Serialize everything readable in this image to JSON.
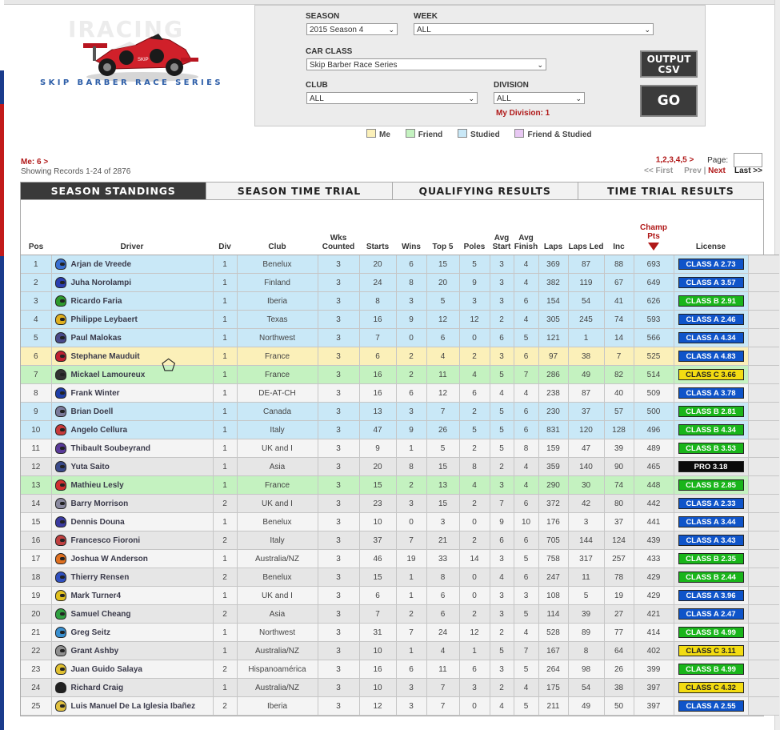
{
  "logo": {
    "word": "IRACING",
    "subtitle": "SKIP BARBER RACE SERIES"
  },
  "filters": {
    "season": {
      "label": "SEASON",
      "value": "2015 Season 4"
    },
    "week": {
      "label": "WEEK",
      "value": "ALL"
    },
    "car_class": {
      "label": "CAR CLASS",
      "value": "Skip Barber Race Series"
    },
    "club": {
      "label": "CLUB",
      "value": "ALL"
    },
    "division": {
      "label": "DIVISION",
      "value": "ALL"
    },
    "my_division": "My Division: 1",
    "output_csv": "OUTPUT CSV",
    "go": "GO"
  },
  "legend": [
    {
      "label": "Me",
      "color": "#fbf0b9"
    },
    {
      "label": "Friend",
      "color": "#c4f2c0"
    },
    {
      "label": "Studied",
      "color": "#c9e8f7"
    },
    {
      "label": "Friend & Studied",
      "color": "#e8c8f3"
    }
  ],
  "me_link": "Me: 6 >",
  "showing": "Showing Records 1-24 of 2876",
  "pagination": {
    "pages": "1,2,3,4,5",
    "next_arrow": ">",
    "page_label": "Page:",
    "first": "<< First",
    "prev": "Prev",
    "sep": "|",
    "next": "Next",
    "last": "Last >>"
  },
  "tabs": [
    "SEASON STANDINGS",
    "SEASON TIME TRIAL",
    "QUALIFYING RESULTS",
    "TIME TRIAL RESULTS"
  ],
  "columns": {
    "pos": "Pos",
    "driver": "Driver",
    "div": "Div",
    "club": "Club",
    "wks": "Wks Counted",
    "starts": "Starts",
    "wins": "Wins",
    "top5": "Top 5",
    "poles": "Poles",
    "avg_start": "Avg Start",
    "avg_finish": "Avg Finish",
    "laps": "Laps",
    "laps_led": "Laps Led",
    "inc": "Inc",
    "champ": "Champ Pts",
    "license": "License"
  },
  "rows": [
    {
      "pos": "1",
      "driver": "Arjan de Vreede",
      "div": "1",
      "club": "Benelux",
      "wks": "3",
      "starts": "20",
      "wins": "6",
      "top5": "15",
      "poles": "5",
      "as": "3",
      "af": "4",
      "laps": "369",
      "led": "87",
      "inc": "88",
      "pts": "693",
      "lic": "CLASS A 2.73",
      "cls": "A",
      "type": "studied",
      "helmet": "#3a6fd1"
    },
    {
      "pos": "2",
      "driver": "Juha Norolampi",
      "div": "1",
      "club": "Finland",
      "wks": "3",
      "starts": "24",
      "wins": "8",
      "top5": "20",
      "poles": "9",
      "as": "3",
      "af": "4",
      "laps": "382",
      "led": "119",
      "inc": "67",
      "pts": "649",
      "lic": "CLASS A 3.57",
      "cls": "A",
      "type": "studied",
      "helmet": "#2b3fb0"
    },
    {
      "pos": "3",
      "driver": "Ricardo Faria",
      "div": "1",
      "club": "Iberia",
      "wks": "3",
      "starts": "8",
      "wins": "3",
      "top5": "5",
      "poles": "3",
      "as": "3",
      "af": "6",
      "laps": "154",
      "led": "54",
      "inc": "41",
      "pts": "626",
      "lic": "CLASS B 2.91",
      "cls": "B",
      "type": "studied",
      "helmet": "#2e9b2e"
    },
    {
      "pos": "4",
      "driver": "Philippe Leybaert",
      "div": "1",
      "club": "Texas",
      "wks": "3",
      "starts": "16",
      "wins": "9",
      "top5": "12",
      "poles": "12",
      "as": "2",
      "af": "4",
      "laps": "305",
      "led": "245",
      "inc": "74",
      "pts": "593",
      "lic": "CLASS A 2.46",
      "cls": "A",
      "type": "studied",
      "helmet": "#e0b020"
    },
    {
      "pos": "5",
      "driver": "Paul Malokas",
      "div": "1",
      "club": "Northwest",
      "wks": "3",
      "starts": "7",
      "wins": "0",
      "top5": "6",
      "poles": "0",
      "as": "6",
      "af": "5",
      "laps": "121",
      "led": "1",
      "inc": "14",
      "pts": "566",
      "lic": "CLASS A 4.34",
      "cls": "A",
      "type": "studied",
      "helmet": "#4a4a8a"
    },
    {
      "pos": "6",
      "driver": "Stephane Mauduit",
      "div": "1",
      "club": "France",
      "wks": "3",
      "starts": "6",
      "wins": "2",
      "top5": "4",
      "poles": "2",
      "as": "3",
      "af": "6",
      "laps": "97",
      "led": "38",
      "inc": "7",
      "pts": "525",
      "lic": "CLASS A 4.83",
      "cls": "A",
      "type": "me",
      "helmet": "#c02030"
    },
    {
      "pos": "7",
      "driver": "Mickael Lamoureux",
      "div": "1",
      "club": "France",
      "wks": "3",
      "starts": "16",
      "wins": "2",
      "top5": "11",
      "poles": "4",
      "as": "5",
      "af": "7",
      "laps": "286",
      "led": "49",
      "inc": "82",
      "pts": "514",
      "lic": "CLASS C 3.66",
      "cls": "C",
      "type": "friend",
      "helmet": "#333333"
    },
    {
      "pos": "8",
      "driver": "Frank Winter",
      "div": "1",
      "club": "DE-AT-CH",
      "wks": "3",
      "starts": "16",
      "wins": "6",
      "top5": "12",
      "poles": "6",
      "as": "4",
      "af": "4",
      "laps": "238",
      "led": "87",
      "inc": "40",
      "pts": "509",
      "lic": "CLASS A 3.78",
      "cls": "A",
      "type": "norm",
      "helmet": "#1f3fa8"
    },
    {
      "pos": "9",
      "driver": "Brian Doell",
      "div": "1",
      "club": "Canada",
      "wks": "3",
      "starts": "13",
      "wins": "3",
      "top5": "7",
      "poles": "2",
      "as": "5",
      "af": "6",
      "laps": "230",
      "led": "37",
      "inc": "57",
      "pts": "500",
      "lic": "CLASS B 2.81",
      "cls": "B",
      "type": "studied",
      "helmet": "#7a7a9a"
    },
    {
      "pos": "10",
      "driver": "Angelo Cellura",
      "div": "1",
      "club": "Italy",
      "wks": "3",
      "starts": "47",
      "wins": "9",
      "top5": "26",
      "poles": "5",
      "as": "5",
      "af": "6",
      "laps": "831",
      "led": "120",
      "inc": "128",
      "pts": "496",
      "lic": "CLASS B 4.34",
      "cls": "B",
      "type": "studied",
      "helmet": "#c83a3a"
    },
    {
      "pos": "11",
      "driver": "Thibault Soubeyrand",
      "div": "1",
      "club": "UK and I",
      "wks": "3",
      "starts": "9",
      "wins": "1",
      "top5": "5",
      "poles": "2",
      "as": "5",
      "af": "8",
      "laps": "159",
      "led": "47",
      "inc": "39",
      "pts": "489",
      "lic": "CLASS B 3.53",
      "cls": "B",
      "type": "norm",
      "helmet": "#5a3a9a"
    },
    {
      "pos": "12",
      "driver": "Yuta Saito",
      "div": "1",
      "club": "Asia",
      "wks": "3",
      "starts": "20",
      "wins": "8",
      "top5": "15",
      "poles": "8",
      "as": "2",
      "af": "4",
      "laps": "359",
      "led": "140",
      "inc": "90",
      "pts": "465",
      "lic": "PRO 3.18",
      "cls": "P",
      "type": "norm alt",
      "helmet": "#3a4a8a"
    },
    {
      "pos": "13",
      "driver": "Mathieu Lesly",
      "div": "1",
      "club": "France",
      "wks": "3",
      "starts": "15",
      "wins": "2",
      "top5": "13",
      "poles": "4",
      "as": "3",
      "af": "4",
      "laps": "290",
      "led": "30",
      "inc": "74",
      "pts": "448",
      "lic": "CLASS B 2.85",
      "cls": "B",
      "type": "friend",
      "helmet": "#d03030"
    },
    {
      "pos": "14",
      "driver": "Barry Morrison",
      "div": "2",
      "club": "UK and I",
      "wks": "3",
      "starts": "23",
      "wins": "3",
      "top5": "15",
      "poles": "2",
      "as": "7",
      "af": "6",
      "laps": "372",
      "led": "42",
      "inc": "80",
      "pts": "442",
      "lic": "CLASS A 2.33",
      "cls": "A",
      "type": "norm alt",
      "helmet": "#8a8aa0"
    },
    {
      "pos": "15",
      "driver": "Dennis Douna",
      "div": "1",
      "club": "Benelux",
      "wks": "3",
      "starts": "10",
      "wins": "0",
      "top5": "3",
      "poles": "0",
      "as": "9",
      "af": "10",
      "laps": "176",
      "led": "3",
      "inc": "37",
      "pts": "441",
      "lic": "CLASS A 3.44",
      "cls": "A",
      "type": "norm",
      "helmet": "#3a3aa0"
    },
    {
      "pos": "16",
      "driver": "Francesco Fioroni",
      "div": "2",
      "club": "Italy",
      "wks": "3",
      "starts": "37",
      "wins": "7",
      "top5": "21",
      "poles": "2",
      "as": "6",
      "af": "6",
      "laps": "705",
      "led": "144",
      "inc": "124",
      "pts": "439",
      "lic": "CLASS A 3.43",
      "cls": "A",
      "type": "norm alt",
      "helmet": "#c04040"
    },
    {
      "pos": "17",
      "driver": "Joshua W Anderson",
      "div": "1",
      "club": "Australia/NZ",
      "wks": "3",
      "starts": "46",
      "wins": "19",
      "top5": "33",
      "poles": "14",
      "as": "3",
      "af": "5",
      "laps": "758",
      "led": "317",
      "inc": "257",
      "pts": "433",
      "lic": "CLASS B 2.35",
      "cls": "B",
      "type": "norm",
      "helmet": "#e07020"
    },
    {
      "pos": "18",
      "driver": "Thierry Rensen",
      "div": "2",
      "club": "Benelux",
      "wks": "3",
      "starts": "15",
      "wins": "1",
      "top5": "8",
      "poles": "0",
      "as": "4",
      "af": "6",
      "laps": "247",
      "led": "11",
      "inc": "78",
      "pts": "429",
      "lic": "CLASS B 2.44",
      "cls": "B",
      "type": "norm alt",
      "helmet": "#3050c0"
    },
    {
      "pos": "19",
      "driver": "Mark Turner4",
      "div": "1",
      "club": "UK and I",
      "wks": "3",
      "starts": "6",
      "wins": "1",
      "top5": "6",
      "poles": "0",
      "as": "3",
      "af": "3",
      "laps": "108",
      "led": "5",
      "inc": "19",
      "pts": "429",
      "lic": "CLASS A 3.96",
      "cls": "A",
      "type": "norm",
      "helmet": "#e0c020"
    },
    {
      "pos": "20",
      "driver": "Samuel Cheang",
      "div": "2",
      "club": "Asia",
      "wks": "3",
      "starts": "7",
      "wins": "2",
      "top5": "6",
      "poles": "2",
      "as": "3",
      "af": "5",
      "laps": "114",
      "led": "39",
      "inc": "27",
      "pts": "421",
      "lic": "CLASS A 2.47",
      "cls": "A",
      "type": "norm alt",
      "helmet": "#30a040"
    },
    {
      "pos": "21",
      "driver": "Greg Seitz",
      "div": "1",
      "club": "Northwest",
      "wks": "3",
      "starts": "31",
      "wins": "7",
      "top5": "24",
      "poles": "12",
      "as": "2",
      "af": "4",
      "laps": "528",
      "led": "89",
      "inc": "77",
      "pts": "414",
      "lic": "CLASS B 4.99",
      "cls": "B",
      "type": "norm",
      "helmet": "#3a90d0"
    },
    {
      "pos": "22",
      "driver": "Grant Ashby",
      "div": "1",
      "club": "Australia/NZ",
      "wks": "3",
      "starts": "10",
      "wins": "1",
      "top5": "4",
      "poles": "1",
      "as": "5",
      "af": "7",
      "laps": "167",
      "led": "8",
      "inc": "64",
      "pts": "402",
      "lic": "CLASS C 3.11",
      "cls": "C",
      "type": "norm alt",
      "helmet": "#909090"
    },
    {
      "pos": "23",
      "driver": "Juan Guido Salaya",
      "div": "2",
      "club": "Hispanoamérica",
      "wks": "3",
      "starts": "16",
      "wins": "6",
      "top5": "11",
      "poles": "6",
      "as": "3",
      "af": "5",
      "laps": "264",
      "led": "98",
      "inc": "26",
      "pts": "399",
      "lic": "CLASS B 4.99",
      "cls": "B",
      "type": "norm",
      "helmet": "#e0c030"
    },
    {
      "pos": "24",
      "driver": "Richard Craig",
      "div": "1",
      "club": "Australia/NZ",
      "wks": "3",
      "starts": "10",
      "wins": "3",
      "top5": "7",
      "poles": "3",
      "as": "2",
      "af": "4",
      "laps": "175",
      "led": "54",
      "inc": "38",
      "pts": "397",
      "lic": "CLASS C 4.32",
      "cls": "C",
      "type": "norm alt",
      "helmet": "#202020"
    },
    {
      "pos": "25",
      "driver": "Luis Manuel De La Iglesia Ibañez",
      "div": "2",
      "club": "Iberia",
      "wks": "3",
      "starts": "12",
      "wins": "3",
      "top5": "7",
      "poles": "0",
      "as": "4",
      "af": "5",
      "laps": "211",
      "led": "49",
      "inc": "50",
      "pts": "397",
      "lic": "CLASS A 2.55",
      "cls": "A",
      "type": "norm",
      "helmet": "#e0c040"
    }
  ]
}
